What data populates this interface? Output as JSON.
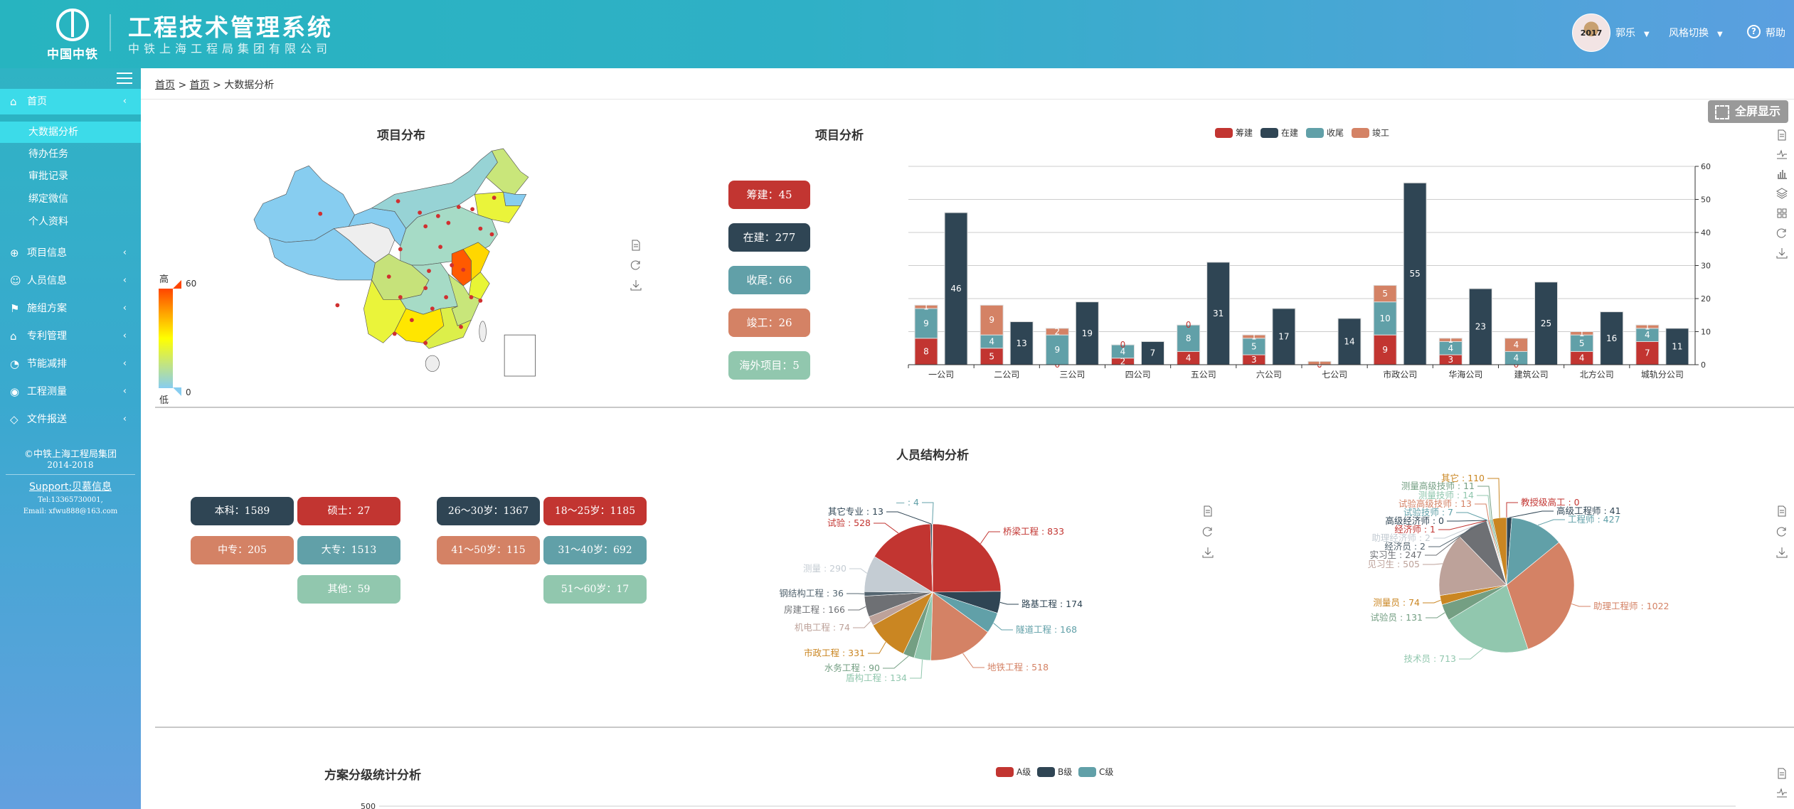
{
  "header": {
    "logo_text": "中国中铁",
    "title": "工程技术管理系统",
    "subtitle": "中铁上海工程局集团有限公司",
    "avatar_text": "2017 1129",
    "user": "郭乐",
    "style_switch": "风格切换",
    "help": "帮助"
  },
  "breadcrumb": {
    "items": [
      "首页",
      "首页"
    ],
    "sep": ">",
    "current": "大数据分析"
  },
  "sidebar": {
    "home": {
      "label": "首页",
      "icon": "home-icon"
    },
    "sub_items": [
      {
        "label": "大数据分析",
        "active": true
      },
      {
        "label": "待办任务"
      },
      {
        "label": "审批记录"
      },
      {
        "label": "绑定微信"
      },
      {
        "label": "个人资料"
      }
    ],
    "menus": [
      {
        "label": "项目信息",
        "icon": "globe-icon"
      },
      {
        "label": "人员信息",
        "icon": "users-icon"
      },
      {
        "label": "施组方案",
        "icon": "signpost-icon"
      },
      {
        "label": "专利管理",
        "icon": "graduation-cap-icon"
      },
      {
        "label": "节能减排",
        "icon": "gauge-icon"
      },
      {
        "label": "工程测量",
        "icon": "location-pin-icon"
      },
      {
        "label": "文件报送",
        "icon": "diamond-icon"
      }
    ],
    "footer": {
      "copyright": "©中铁上海工程局集团",
      "years": "2014-2018",
      "support": "Support:贝慕信息",
      "tel": "Tel:13365730001,",
      "email": "Email: xfwu888@163.com"
    }
  },
  "fullscreen_label": "全屏显示",
  "map_section": {
    "title": "项目分布",
    "visual_map": {
      "high_label": "高",
      "low_label": "低",
      "max": "60",
      "min": "0",
      "colors": [
        "#ff4500",
        "#ffa500",
        "#ffff00",
        "#c5e57c",
        "#87cdf0"
      ]
    }
  },
  "project_section": {
    "title": "项目分析",
    "tags": [
      {
        "label": "筹建：45",
        "color": "#c23531"
      },
      {
        "label": "在建：277",
        "color": "#2f4554"
      },
      {
        "label": "收尾：66",
        "color": "#61a0a8"
      },
      {
        "label": "竣工：26",
        "color": "#d48265"
      },
      {
        "label": "海外项目：5",
        "color": "#91c7ae"
      }
    ]
  },
  "staff_section": {
    "title": "人员结构分析",
    "edu_tags": [
      {
        "label": "本科：1589",
        "color": "#2f4554"
      },
      {
        "label": "硕士：27",
        "color": "#c23531"
      },
      {
        "label": "中专：205",
        "color": "#d48265"
      },
      {
        "label": "大专：1513",
        "color": "#61a0a8"
      },
      {
        "label": "其他：59",
        "color": "#91c7ae"
      }
    ],
    "age_tags": [
      {
        "label": "26～30岁：1367",
        "color": "#2f4554"
      },
      {
        "label": "18～25岁：1185",
        "color": "#c23531"
      },
      {
        "label": "41～50岁：115",
        "color": "#d48265"
      },
      {
        "label": "31～40岁：692",
        "color": "#61a0a8"
      },
      {
        "label": "51～60岁：17",
        "color": "#91c7ae"
      }
    ]
  },
  "scheme_section": {
    "title": "方案分级统计分析"
  },
  "palette": [
    "#c23531",
    "#2f4554",
    "#61a0a8",
    "#d48265",
    "#91c7ae",
    "#749f83",
    "#ca8622",
    "#bda29a",
    "#6e7074",
    "#546570",
    "#c4ccd3"
  ],
  "toolbox_icons": [
    "data-view-icon",
    "line-chart-icon",
    "bar-chart-icon",
    "stack-icon",
    "tiled-icon",
    "restore-icon",
    "save-image-icon"
  ],
  "chart_data": [
    {
      "type": "bar",
      "stacked": true,
      "legend": [
        "筹建",
        "在建",
        "收尾",
        "竣工"
      ],
      "legend_position": "top",
      "grid": true,
      "ylim": [
        0,
        60
      ],
      "yticks": [
        0,
        10,
        20,
        30,
        40,
        50,
        60
      ],
      "categories": [
        "一公司",
        "二公司",
        "三公司",
        "四公司",
        "五公司",
        "六公司",
        "七公司",
        "市政公司",
        "华海公司",
        "建筑公司",
        "北方公司",
        "城轨分公司"
      ],
      "series": [
        {
          "name": "筹建",
          "stack": "a",
          "values": [
            8,
            5,
            0,
            2,
            4,
            3,
            0,
            9,
            3,
            0,
            4,
            7
          ]
        },
        {
          "name": "收尾",
          "stack": "a",
          "values": [
            9,
            4,
            9,
            4,
            8,
            5,
            0,
            10,
            4,
            4,
            5,
            4
          ]
        },
        {
          "name": "竣工",
          "stack": "a",
          "values": [
            1,
            9,
            2,
            0,
            0,
            1,
            1,
            5,
            1,
            4,
            1,
            1
          ]
        },
        {
          "name": "在建",
          "stack": "b",
          "values": [
            46,
            13,
            19,
            7,
            31,
            17,
            14,
            55,
            23,
            25,
            16,
            11
          ]
        }
      ]
    },
    {
      "type": "pie",
      "slices": [
        {
          "name": "桥梁工程",
          "value": 833
        },
        {
          "name": "路基工程",
          "value": 174
        },
        {
          "name": "隧道工程",
          "value": 168
        },
        {
          "name": "地铁工程",
          "value": 518
        },
        {
          "name": "盾构工程",
          "value": 134
        },
        {
          "name": "水务工程",
          "value": 90
        },
        {
          "name": "市政工程",
          "value": 331
        },
        {
          "name": "机电工程",
          "value": 74
        },
        {
          "name": "房建工程",
          "value": 166
        },
        {
          "name": "钢结构工程",
          "value": 36
        },
        {
          "name": "测量",
          "value": 290
        },
        {
          "name": "试验",
          "value": 528
        },
        {
          "name": "其它专业",
          "value": 13
        },
        {
          "name": "—",
          "value": 4
        }
      ]
    },
    {
      "type": "pie",
      "slices": [
        {
          "name": "教授级高工",
          "value": 0
        },
        {
          "name": "高级工程师",
          "value": 41
        },
        {
          "name": "工程师",
          "value": 427
        },
        {
          "name": "助理工程师",
          "value": 1022
        },
        {
          "name": "技术员",
          "value": 713
        },
        {
          "name": "试验员",
          "value": 131
        },
        {
          "name": "测量员",
          "value": 74
        },
        {
          "name": "见习生",
          "value": 505
        },
        {
          "name": "实习生",
          "value": 247
        },
        {
          "name": "经济员",
          "value": 2
        },
        {
          "name": "助理经济师",
          "value": 2
        },
        {
          "name": "经济师",
          "value": 1
        },
        {
          "name": "高级经济师",
          "value": 0
        },
        {
          "name": "试验技师",
          "value": 7
        },
        {
          "name": "试验高级技师",
          "value": 13
        },
        {
          "name": "测量技师",
          "value": 14
        },
        {
          "name": "测量高级技师",
          "value": 11
        },
        {
          "name": "其它",
          "value": 110
        }
      ]
    },
    {
      "type": "bar",
      "legend": [
        "A级",
        "B级",
        "C级"
      ],
      "legend_position": "top",
      "yticks": [
        500
      ]
    }
  ]
}
